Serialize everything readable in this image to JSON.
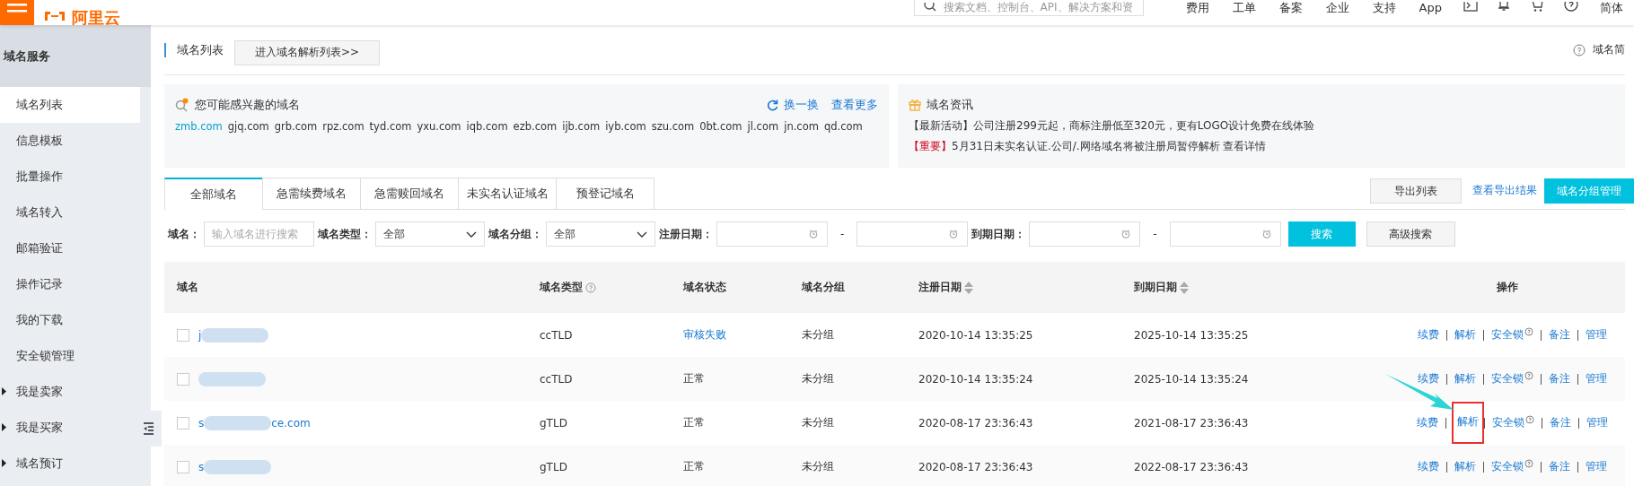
{
  "topbar": {
    "logo": "阿里云",
    "search": {
      "placeholder": "搜索文档、控制台、API、解决方案和资"
    },
    "links": [
      "费用",
      "工单",
      "备案",
      "企业",
      "支持",
      "App"
    ],
    "language": "简体"
  },
  "sidebar": {
    "title": "域名服务",
    "items": [
      {
        "label": "域名列表",
        "selected": true,
        "expandable": false
      },
      {
        "label": "信息模板",
        "selected": false,
        "expandable": false
      },
      {
        "label": "批量操作",
        "selected": false,
        "expandable": false
      },
      {
        "label": "域名转入",
        "selected": false,
        "expandable": false
      },
      {
        "label": "邮箱验证",
        "selected": false,
        "expandable": false
      },
      {
        "label": "操作记录",
        "selected": false,
        "expandable": false
      },
      {
        "label": "我的下载",
        "selected": false,
        "expandable": false
      },
      {
        "label": "安全锁管理",
        "selected": false,
        "expandable": false
      },
      {
        "label": "我是卖家",
        "selected": false,
        "expandable": true
      },
      {
        "label": "我是买家",
        "selected": false,
        "expandable": true
      },
      {
        "label": "域名预订",
        "selected": false,
        "expandable": true
      }
    ]
  },
  "header": {
    "title": "域名列表",
    "button": "进入域名解析列表>>",
    "help": "域名简"
  },
  "suggest": {
    "title": "您可能感兴趣的域名",
    "refresh": "换一换",
    "more": "查看更多",
    "domains": [
      {
        "name": "zmb.com",
        "selected": true
      },
      {
        "name": "gjq.com",
        "selected": false
      },
      {
        "name": "grb.com",
        "selected": false
      },
      {
        "name": "rpz.com",
        "selected": false
      },
      {
        "name": "tyd.com",
        "selected": false
      },
      {
        "name": "yxu.com",
        "selected": false
      },
      {
        "name": "iqb.com",
        "selected": false
      },
      {
        "name": "ezb.com",
        "selected": false
      },
      {
        "name": "ijb.com",
        "selected": false
      },
      {
        "name": "iyb.com",
        "selected": false
      },
      {
        "name": "szu.com",
        "selected": false
      },
      {
        "name": "0bt.com",
        "selected": false
      },
      {
        "name": "jl.com",
        "selected": false
      },
      {
        "name": "jn.com",
        "selected": false
      },
      {
        "name": "qd.com",
        "selected": false
      }
    ]
  },
  "news": {
    "title": "域名资讯",
    "items": [
      {
        "tag": "【最新活动】",
        "text": "公司注册299元起，商标注册低至320元，更有LOGO设计免费在线体验",
        "important": false
      },
      {
        "tag": "【重要】",
        "text": "5月31日未实名认证.公司/.网络域名将被注册局暂停解析 查看详情",
        "important": true
      }
    ]
  },
  "tabs": [
    {
      "label": "全部域名",
      "selected": true
    },
    {
      "label": "急需续费域名",
      "selected": false
    },
    {
      "label": "急需赎回域名",
      "selected": false
    },
    {
      "label": "未实名认证域名",
      "selected": false
    },
    {
      "label": "预登记域名",
      "selected": false
    }
  ],
  "actions": {
    "export": "导出列表",
    "view_export": "查看导出结果",
    "group_manage": "域名分组管理"
  },
  "filters": {
    "domain_label": "域名：",
    "domain_placeholder": "输入域名进行搜索",
    "type_label": "域名类型：",
    "type_value": "全部",
    "group_label": "域名分组：",
    "group_value": "全部",
    "reg_label": "注册日期：",
    "exp_label": "到期日期：",
    "dash": "-",
    "search": "搜索",
    "advanced": "高级搜索"
  },
  "table": {
    "columns": [
      "域名",
      "域名类型",
      "域名状态",
      "域名分组",
      "注册日期",
      "到期日期",
      "操作"
    ],
    "rows": [
      {
        "checked": false,
        "domain_parts": [
          "j"
        ],
        "type": "ccTLD",
        "status": "审核失败",
        "status_link": true,
        "group": "未分组",
        "registered": "2020-10-14 13:35:25",
        "expires": "2025-10-14 13:35:25",
        "ops": [
          "续费",
          "解析",
          "安全锁",
          "备注",
          "管理"
        ],
        "highlighted": false
      },
      {
        "checked": false,
        "domain_parts": [],
        "type": "ccTLD",
        "status": "正常",
        "status_link": false,
        "group": "未分组",
        "registered": "2020-10-14 13:35:24",
        "expires": "2025-10-14 13:35:24",
        "ops": [
          "续费",
          "解析",
          "安全锁",
          "备注",
          "管理"
        ],
        "highlighted": false
      },
      {
        "checked": false,
        "domain_parts": [
          "s",
          "ce.com"
        ],
        "type": "gTLD",
        "status": "正常",
        "status_link": false,
        "group": "未分组",
        "registered": "2020-08-17 23:36:43",
        "expires": "2021-08-17 23:36:43",
        "ops": [
          "续费",
          "解析",
          "安全锁",
          "备注",
          "管理"
        ],
        "highlighted": true
      },
      {
        "checked": false,
        "domain_parts": [
          "s"
        ],
        "type": "gTLD",
        "status": "正常",
        "status_link": false,
        "group": "未分组",
        "registered": "2020-08-17 23:36:43",
        "expires": "2022-08-17 23:36:43",
        "ops": [
          "续费",
          "解析",
          "安全锁",
          "备注",
          "管理"
        ],
        "highlighted": false
      }
    ]
  }
}
